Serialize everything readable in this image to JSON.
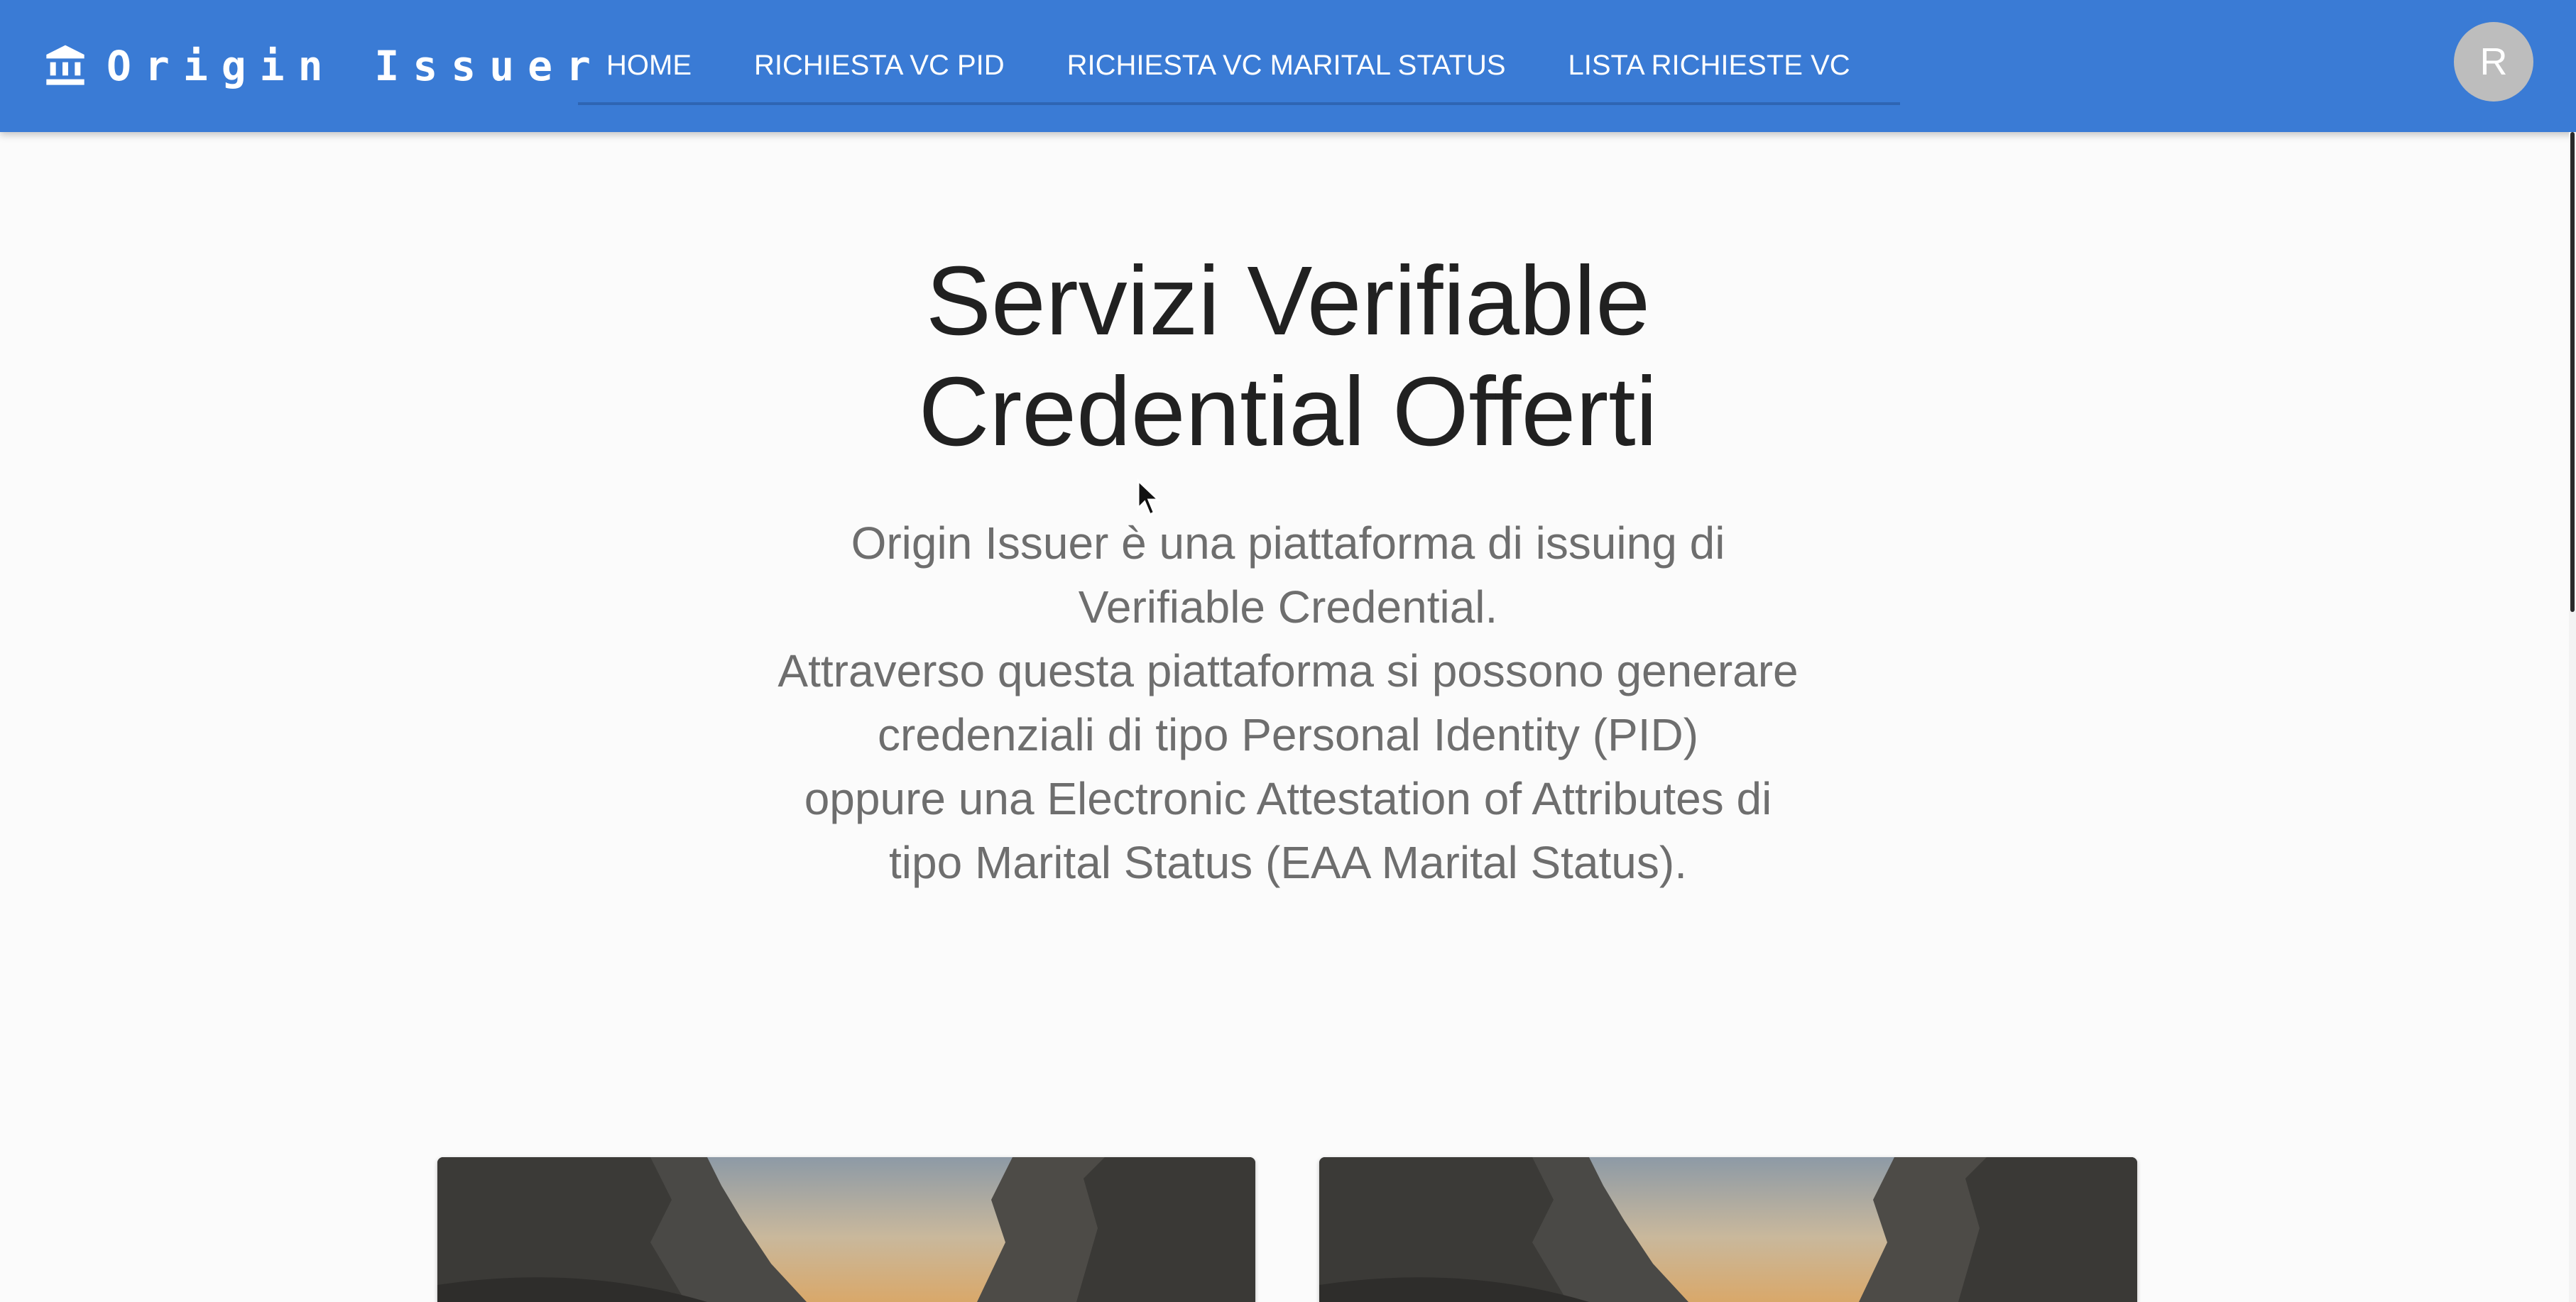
{
  "app": {
    "brand_title": "Origin Issuer",
    "brand_icon": "bank-icon"
  },
  "nav": {
    "items": [
      {
        "label": "HOME"
      },
      {
        "label": "RICHIESTA VC PID"
      },
      {
        "label": "RICHIESTA VC MARITAL STATUS"
      },
      {
        "label": "LISTA RICHIESTE VC"
      }
    ]
  },
  "user": {
    "avatar_initial": "R"
  },
  "hero": {
    "title": "Servizi Verifiable Credential Offerti",
    "description_lines": [
      "Origin Issuer è una piattaforma di issuing di",
      "Verifiable Credential.",
      "Attraverso questa piattaforma si possono generare",
      "credenziali di tipo Personal Identity (PID)",
      "oppure una Electronic Attestation of Attributes di",
      "tipo Marital Status (EAA Marital Status)."
    ]
  },
  "cards": [
    {
      "image": "landscape-cliffs-image"
    },
    {
      "image": "landscape-cliffs-image"
    }
  ],
  "colors": {
    "appbar": "#3a7bd5",
    "background": "#fbfbfb",
    "title_text": "#212121",
    "body_text": "#6e6e6e",
    "avatar": "#bdbdbd"
  }
}
